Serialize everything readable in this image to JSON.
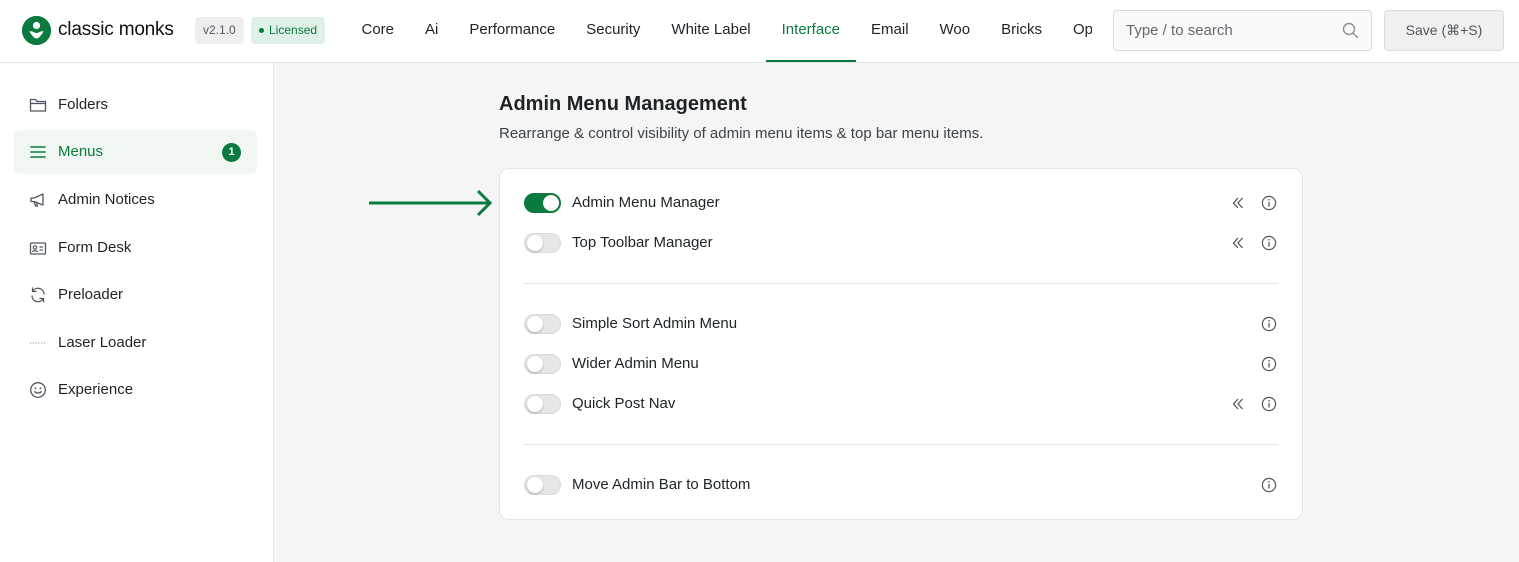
{
  "brand": {
    "name": "classic monks",
    "version": "v2.1.0",
    "license": "Licensed",
    "accent_color": "#0b7a3e"
  },
  "nav": {
    "tabs": [
      {
        "label": "Core",
        "active": false
      },
      {
        "label": "Ai",
        "active": false
      },
      {
        "label": "Performance",
        "active": false
      },
      {
        "label": "Security",
        "active": false
      },
      {
        "label": "White Label",
        "active": false
      },
      {
        "label": "Interface",
        "active": true
      },
      {
        "label": "Email",
        "active": false
      },
      {
        "label": "Woo",
        "active": false
      },
      {
        "label": "Bricks",
        "active": false
      },
      {
        "label": "Opt",
        "active": false
      }
    ]
  },
  "search": {
    "placeholder": "Type / to search",
    "icon": "search-icon"
  },
  "save": {
    "label": "Save (⌘+S)"
  },
  "sidebar": {
    "items": [
      {
        "label": "Folders",
        "icon": "folder-icon",
        "active": false
      },
      {
        "label": "Menus",
        "icon": "menu-lines-icon",
        "active": true,
        "badge": "1"
      },
      {
        "label": "Admin Notices",
        "icon": "megaphone-icon",
        "active": false
      },
      {
        "label": "Form Desk",
        "icon": "id-card-icon",
        "active": false
      },
      {
        "label": "Preloader",
        "icon": "refresh-icon",
        "active": false
      },
      {
        "label": "Laser Loader",
        "icon": "dotted-line-icon",
        "active": false
      },
      {
        "label": "Experience",
        "icon": "smiley-icon",
        "active": false
      }
    ]
  },
  "main": {
    "title": "Admin Menu Management",
    "subtitle": "Rearrange & control visibility of admin menu items & top bar menu items.",
    "settings": [
      {
        "label": "Admin Menu Manager",
        "enabled": true,
        "has_collapse": true
      },
      {
        "label": "Top Toolbar Manager",
        "enabled": false,
        "has_collapse": true
      },
      {
        "label": "Simple Sort Admin Menu",
        "enabled": false,
        "has_collapse": false
      },
      {
        "label": "Wider Admin Menu",
        "enabled": false,
        "has_collapse": false
      },
      {
        "label": "Quick Post Nav",
        "enabled": false,
        "has_collapse": true
      },
      {
        "label": "Move Admin Bar to Bottom",
        "enabled": false,
        "has_collapse": false
      }
    ]
  }
}
